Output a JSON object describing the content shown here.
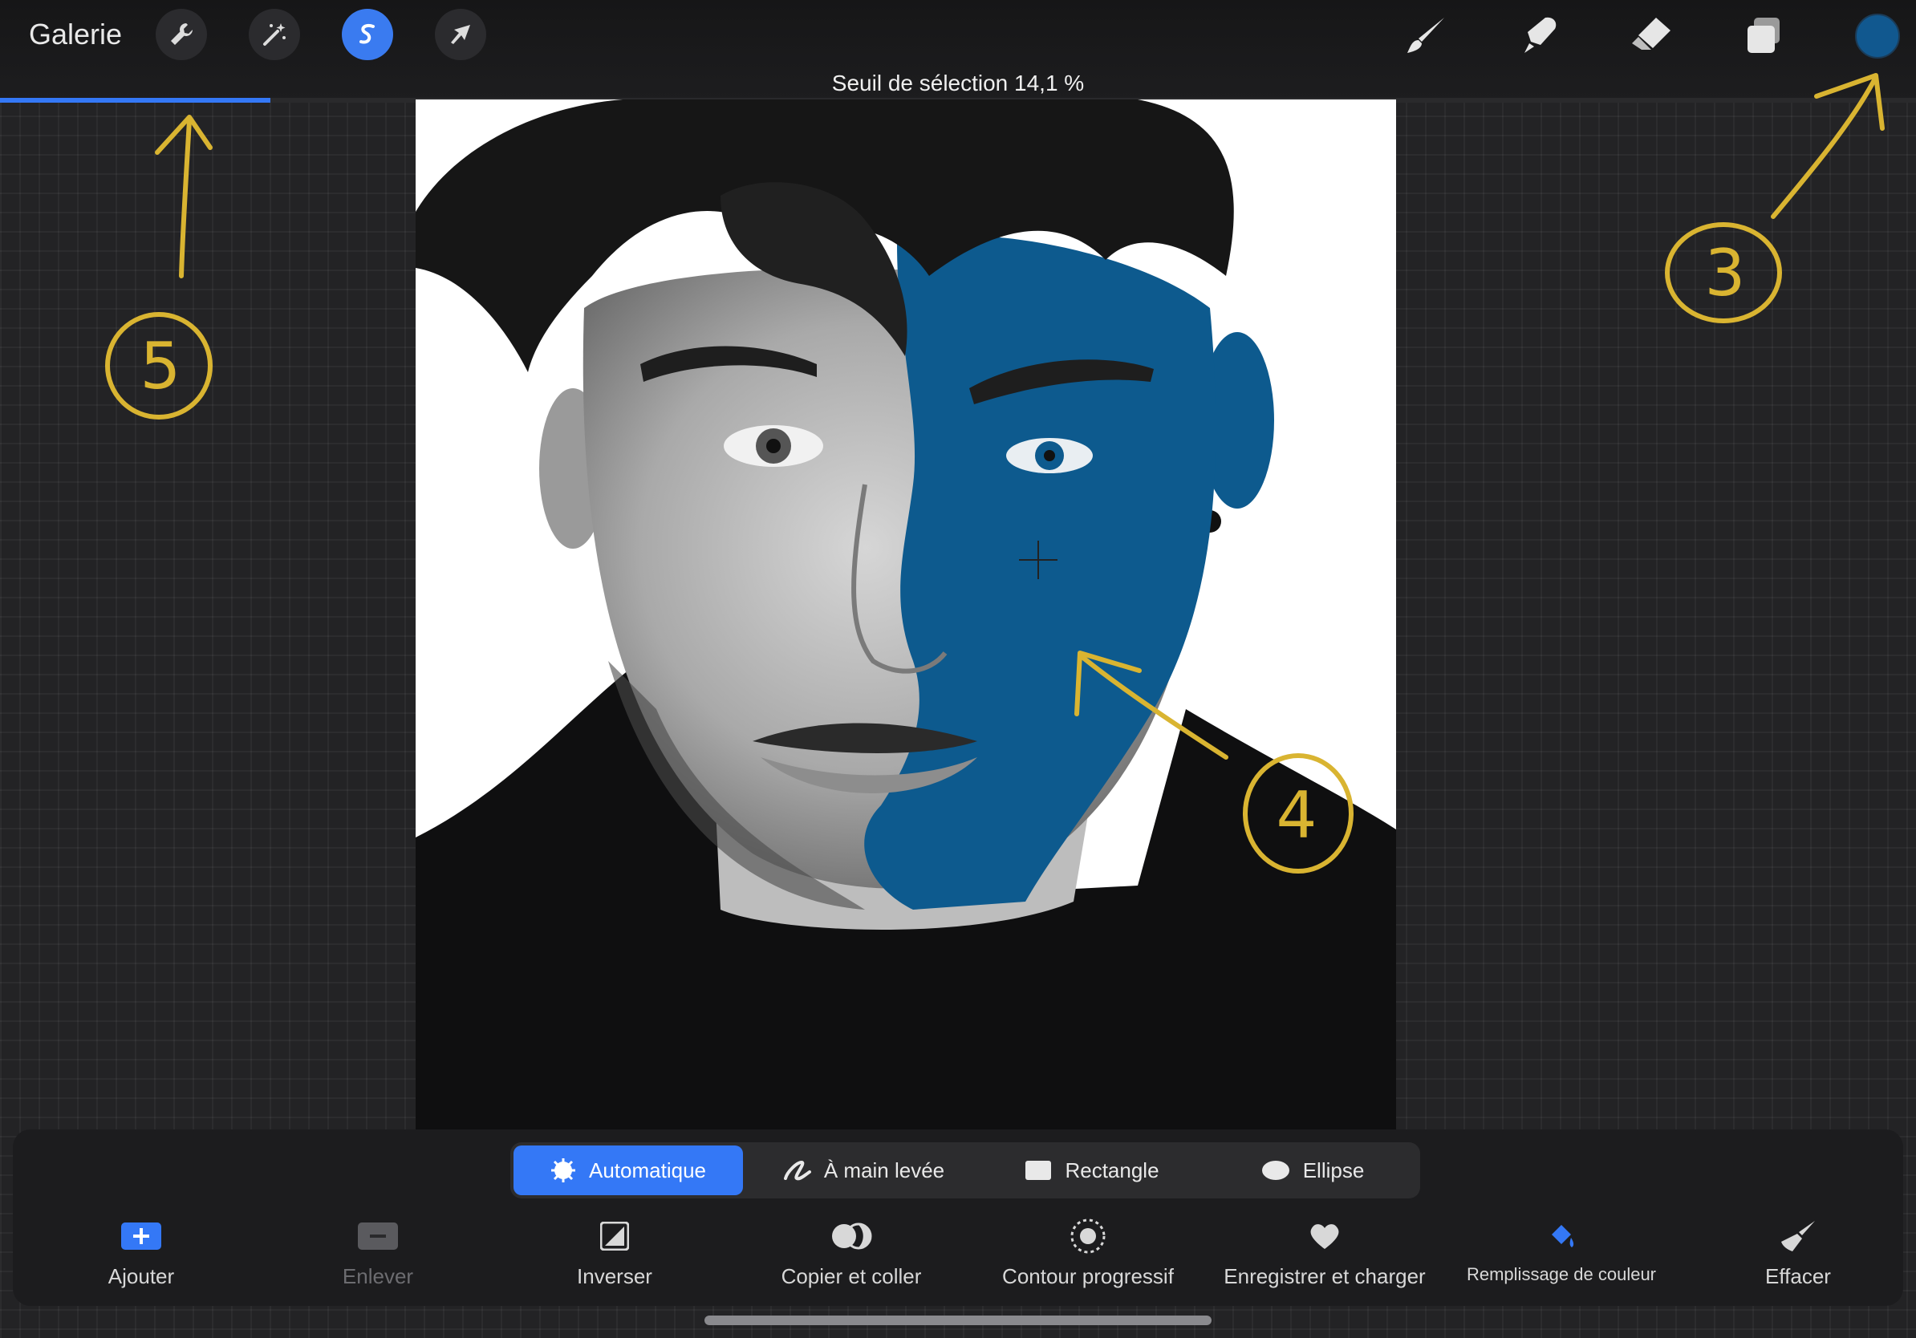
{
  "topbar": {
    "gallery": "Galerie",
    "tools_left": [
      {
        "name": "wrench-icon"
      },
      {
        "name": "magic-wand-icon"
      },
      {
        "name": "selection-icon",
        "active": true
      },
      {
        "name": "transform-arrow-icon"
      }
    ],
    "tools_right": [
      "brush-icon",
      "smudge-icon",
      "eraser-icon",
      "layers-icon"
    ],
    "current_color": "#11588f"
  },
  "threshold": {
    "label": "Seuil de sélection 14,1 %",
    "value_percent": 14.1
  },
  "canvas": {
    "selection_color": "#0d5a8e",
    "annotation_color": "#d9b431",
    "annotations": [
      "5",
      "3",
      "4"
    ]
  },
  "modes": [
    {
      "label": "Automatique",
      "icon": "auto-starburst-icon",
      "active": true
    },
    {
      "label": "À main levée",
      "icon": "freehand-icon",
      "active": false
    },
    {
      "label": "Rectangle",
      "icon": "rectangle-icon",
      "active": false
    },
    {
      "label": "Ellipse",
      "icon": "ellipse-icon",
      "active": false
    }
  ],
  "actions": [
    {
      "label": "Ajouter",
      "icon": "plus-icon",
      "enabled": true
    },
    {
      "label": "Enlever",
      "icon": "minus-icon",
      "enabled": false
    },
    {
      "label": "Inverser",
      "icon": "invert-icon",
      "enabled": true
    },
    {
      "label": "Copier et coller",
      "icon": "copy-paste-icon",
      "enabled": true
    },
    {
      "label": "Contour progressif",
      "icon": "feather-icon",
      "enabled": true
    },
    {
      "label": "Enregistrer et charger",
      "icon": "heart-icon",
      "enabled": true
    },
    {
      "label": "Remplissage de couleur",
      "icon": "color-fill-icon",
      "enabled": true
    },
    {
      "label": "Effacer",
      "icon": "clear-brush-icon",
      "enabled": true
    }
  ]
}
